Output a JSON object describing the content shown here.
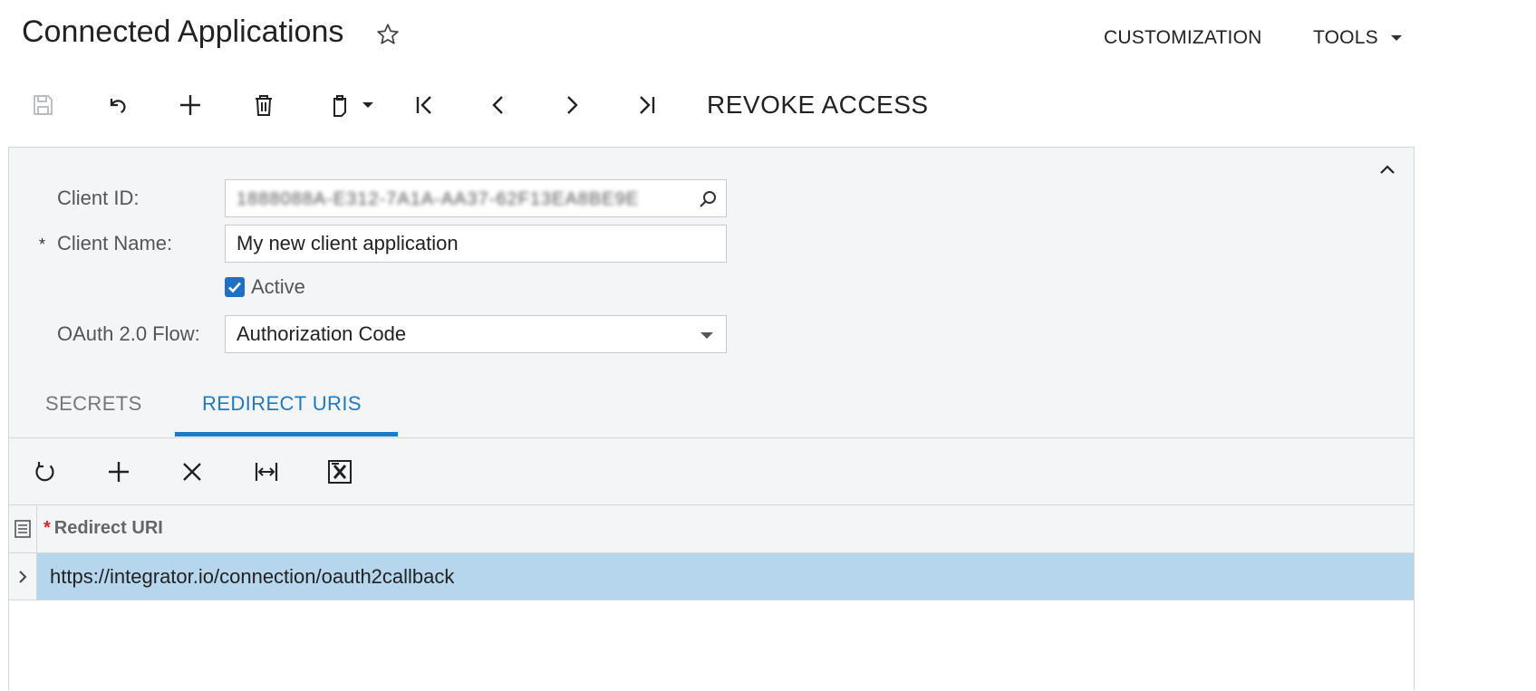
{
  "header": {
    "title": "Connected Applications",
    "menu_customization": "CUSTOMIZATION",
    "menu_tools": "TOOLS"
  },
  "toolbar": {
    "buttons": [
      "save-icon",
      "undo-icon",
      "add-icon",
      "delete-icon",
      "clipboard-icon",
      "first-record-icon",
      "previous-record-icon",
      "next-record-icon",
      "last-record-icon"
    ],
    "revoke_label": "REVOKE ACCESS"
  },
  "form": {
    "client_id_label": "Client ID:",
    "client_id_value": "1888088A-E312-7A1A-AA37-62F13EA8BE9E",
    "client_name_required": "*",
    "client_name_label": "Client Name:",
    "client_name_value": "My new client application",
    "active_label": "Active",
    "active_checked": true,
    "oauth_flow_label": "OAuth 2.0 Flow:",
    "oauth_flow_value": "Authorization Code"
  },
  "tabs": {
    "secrets": "SECRETS",
    "redirect_uris": "REDIRECT URIS",
    "active_tab": "REDIRECT URIS"
  },
  "grid": {
    "toolbar_buttons": [
      "refresh-icon",
      "add-row-icon",
      "delete-row-icon",
      "fit-columns-icon",
      "export-excel-icon"
    ],
    "required_marker": "*",
    "column_header": "Redirect URI",
    "rows": [
      {
        "redirect_uri": "https://integrator.io/connection/oauth2callback"
      }
    ]
  },
  "colors": {
    "accent": "#1f7ac0",
    "selected_row": "#b6d6ee",
    "panel_bg": "#f4f5f7",
    "required_star": "#d9262a"
  }
}
